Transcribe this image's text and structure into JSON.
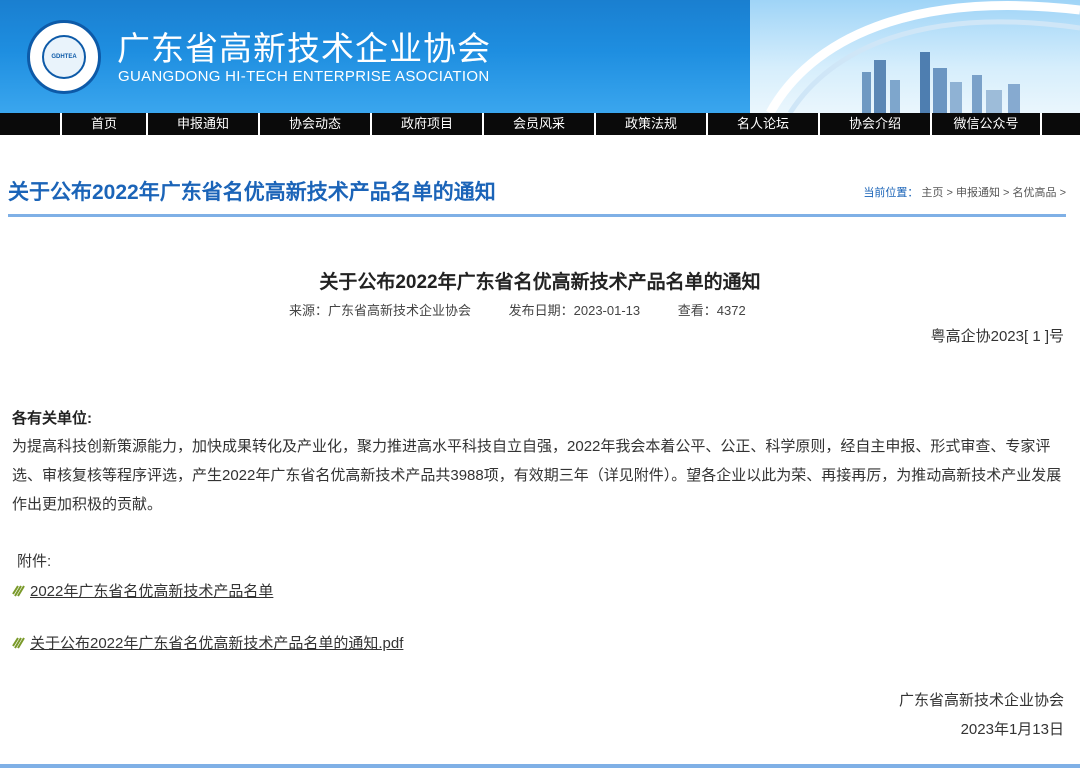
{
  "header": {
    "title_cn": "广东省高新技术企业协会",
    "title_en": "GUANGDONG HI-TECH ENTERPRISE ASOCIATION",
    "logo_text": "GDHTEA"
  },
  "nav": {
    "items": [
      "首页",
      "申报通知",
      "协会动态",
      "政府项目",
      "会员风采",
      "政策法规",
      "名人论坛",
      "协会介绍",
      "微信公众号"
    ]
  },
  "page": {
    "heading": "关于公布2022年广东省名优高新技术产品名单的通知",
    "breadcrumb_label": "当前位置：",
    "breadcrumb": [
      "主页",
      "申报通知",
      "名优高品"
    ]
  },
  "article": {
    "title": "关于公布2022年广东省名优高新技术产品名单的通知",
    "source": "来源：广东省高新技术企业协会",
    "date": "发布日期：2023-01-13",
    "views": "查看：4372",
    "doc_number": "粤高企协2023[ 1 ]号",
    "salutation": "各有关单位:",
    "body": "为提高科技创新策源能力，加快成果转化及产业化，聚力推进高水平科技自立自强，2022年我会本着公平、公正、科学原则，经自主申报、形式审查、专家评选、审核复核等程序评选，产生2022年广东省名优高新技术产品共3988项，有效期三年（详见附件）。望各企业以此为荣、再接再厉，为推动高新技术产业发展作出更加积极的贡献。",
    "attachments_label": "附件:",
    "attachments": [
      "2022年广东省名优高新技术产品名单",
      "关于公布2022年广东省名优高新技术产品名单的通知.pdf"
    ],
    "signature": "广东省高新技术企业协会",
    "signature_date": "2023年1月13日"
  },
  "colors": {
    "accent": "#1b64b8",
    "banner": "#1e8ee0",
    "nav_bg": "#0a0a0a",
    "rule": "#7fb0e6"
  }
}
